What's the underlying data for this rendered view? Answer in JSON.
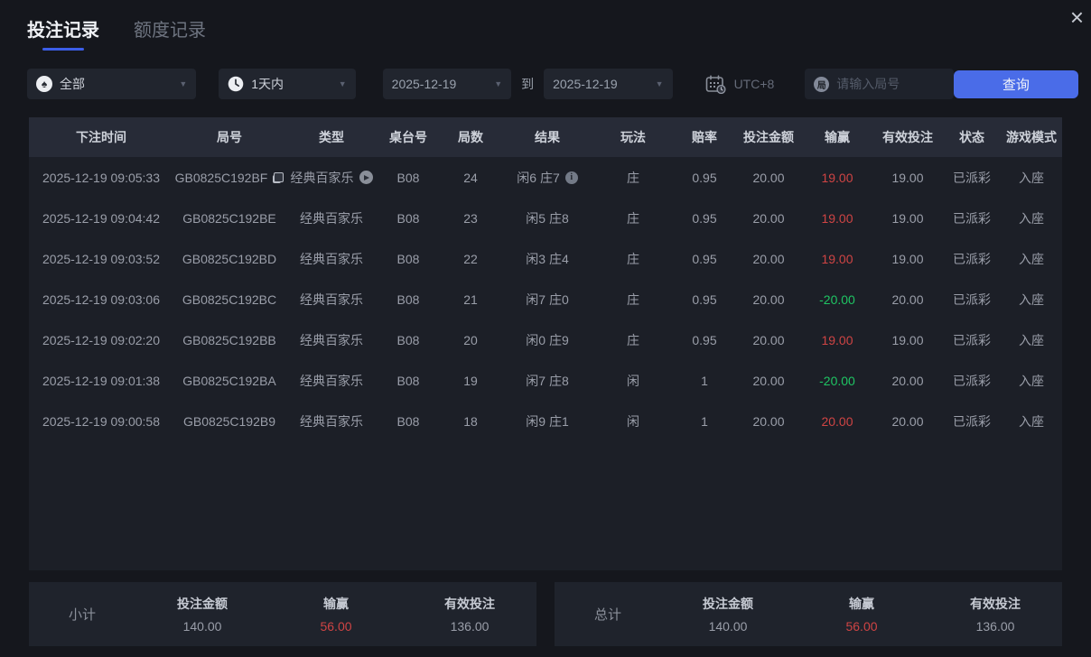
{
  "window": {
    "close_icon": "×"
  },
  "tabs": [
    {
      "label": "投注记录",
      "active": true
    },
    {
      "label": "额度记录",
      "active": false
    }
  ],
  "filters": {
    "game_type": {
      "icon": "spade-icon",
      "glyph": "♠",
      "value": "全部"
    },
    "time_range": {
      "icon": "clock-icon",
      "value": "1天内"
    },
    "date_from": {
      "value": "2025-12-19"
    },
    "to_label": "到",
    "date_to": {
      "value": "2025-12-19"
    },
    "timezone": {
      "icon": "calendar-clock-icon",
      "label": "UTC+8"
    },
    "round_search": {
      "icon": "round-badge-icon",
      "badge_char": "局",
      "placeholder": "请输入局号"
    },
    "query_button": {
      "label": "查询"
    }
  },
  "icons": {
    "info_glyph": "i"
  },
  "table": {
    "columns": [
      "下注时间",
      "局号",
      "类型",
      "桌台号",
      "局数",
      "结果",
      "玩法",
      "赔率",
      "投注金额",
      "输赢",
      "有效投注",
      "状态",
      "游戏模式"
    ],
    "rows": [
      {
        "time": "2025-12-19 09:05:33",
        "round_id": "GB0825C192BF",
        "copy_icon": true,
        "game": "经典百家乐",
        "replay_icon": true,
        "table_no": "B08",
        "rounds": "24",
        "result": "闲6 庄7",
        "info_icon": true,
        "play": "庄",
        "odds": "0.95",
        "bet_amount": "20.00",
        "win_loss": "19.00",
        "win_loss_color": "red",
        "valid_bet": "19.00",
        "status": "已派彩",
        "mode": "入座"
      },
      {
        "time": "2025-12-19 09:04:42",
        "round_id": "GB0825C192BE",
        "copy_icon": false,
        "game": "经典百家乐",
        "replay_icon": false,
        "table_no": "B08",
        "rounds": "23",
        "result": "闲5 庄8",
        "info_icon": false,
        "play": "庄",
        "odds": "0.95",
        "bet_amount": "20.00",
        "win_loss": "19.00",
        "win_loss_color": "red",
        "valid_bet": "19.00",
        "status": "已派彩",
        "mode": "入座"
      },
      {
        "time": "2025-12-19 09:03:52",
        "round_id": "GB0825C192BD",
        "copy_icon": false,
        "game": "经典百家乐",
        "replay_icon": false,
        "table_no": "B08",
        "rounds": "22",
        "result": "闲3 庄4",
        "info_icon": false,
        "play": "庄",
        "odds": "0.95",
        "bet_amount": "20.00",
        "win_loss": "19.00",
        "win_loss_color": "red",
        "valid_bet": "19.00",
        "status": "已派彩",
        "mode": "入座"
      },
      {
        "time": "2025-12-19 09:03:06",
        "round_id": "GB0825C192BC",
        "copy_icon": false,
        "game": "经典百家乐",
        "replay_icon": false,
        "table_no": "B08",
        "rounds": "21",
        "result": "闲7 庄0",
        "info_icon": false,
        "play": "庄",
        "odds": "0.95",
        "bet_amount": "20.00",
        "win_loss": "-20.00",
        "win_loss_color": "green",
        "valid_bet": "20.00",
        "status": "已派彩",
        "mode": "入座"
      },
      {
        "time": "2025-12-19 09:02:20",
        "round_id": "GB0825C192BB",
        "copy_icon": false,
        "game": "经典百家乐",
        "replay_icon": false,
        "table_no": "B08",
        "rounds": "20",
        "result": "闲0 庄9",
        "info_icon": false,
        "play": "庄",
        "odds": "0.95",
        "bet_amount": "20.00",
        "win_loss": "19.00",
        "win_loss_color": "red",
        "valid_bet": "19.00",
        "status": "已派彩",
        "mode": "入座"
      },
      {
        "time": "2025-12-19 09:01:38",
        "round_id": "GB0825C192BA",
        "copy_icon": false,
        "game": "经典百家乐",
        "replay_icon": false,
        "table_no": "B08",
        "rounds": "19",
        "result": "闲7 庄8",
        "info_icon": false,
        "play": "闲",
        "odds": "1",
        "bet_amount": "20.00",
        "win_loss": "-20.00",
        "win_loss_color": "green",
        "valid_bet": "20.00",
        "status": "已派彩",
        "mode": "入座"
      },
      {
        "time": "2025-12-19 09:00:58",
        "round_id": "GB0825C192B9",
        "copy_icon": false,
        "game": "经典百家乐",
        "replay_icon": false,
        "table_no": "B08",
        "rounds": "18",
        "result": "闲9 庄1",
        "info_icon": false,
        "play": "闲",
        "odds": "1",
        "bet_amount": "20.00",
        "win_loss": "20.00",
        "win_loss_color": "red",
        "valid_bet": "20.00",
        "status": "已派彩",
        "mode": "入座"
      }
    ]
  },
  "summary": {
    "subtotal": {
      "label": "小计",
      "items": [
        {
          "label": "投注金额",
          "value": "140.00",
          "color": "normal"
        },
        {
          "label": "输赢",
          "value": "56.00",
          "color": "red"
        },
        {
          "label": "有效投注",
          "value": "136.00",
          "color": "normal"
        }
      ]
    },
    "total": {
      "label": "总计",
      "items": [
        {
          "label": "投注金额",
          "value": "140.00",
          "color": "normal"
        },
        {
          "label": "输赢",
          "value": "56.00",
          "color": "red"
        },
        {
          "label": "有效投注",
          "value": "136.00",
          "color": "normal"
        }
      ]
    }
  },
  "colors": {
    "accent_blue": "#4a6ce8",
    "win_red": "#cf4444",
    "loss_green": "#1fc463"
  }
}
